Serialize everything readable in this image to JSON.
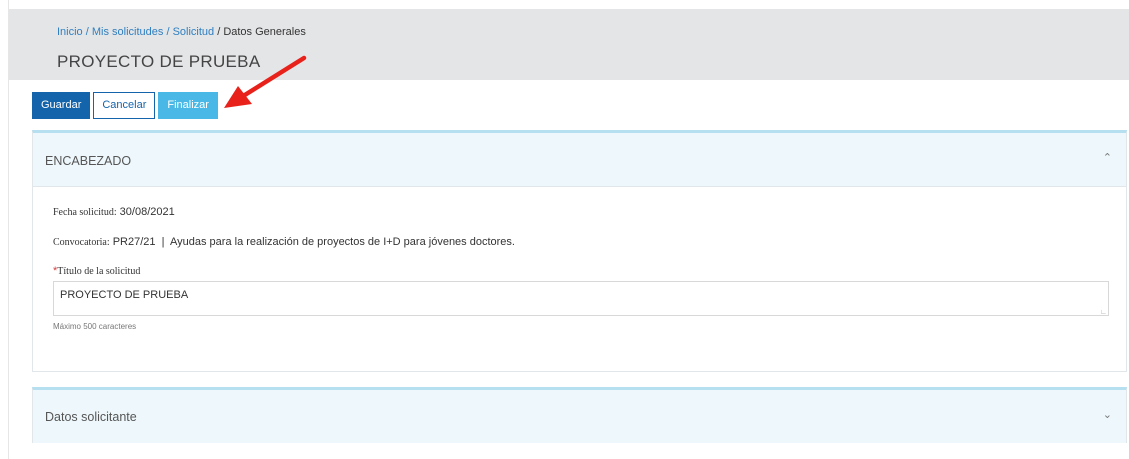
{
  "breadcrumb": {
    "inicio": "Inicio",
    "mis_solicitudes": "Mis solicitudes",
    "solicitud": "Solicitud",
    "current": "Datos Generales",
    "separator": " / "
  },
  "page": {
    "title": "PROYECTO DE PRUEBA"
  },
  "toolbar": {
    "guardar": "Guardar",
    "cancelar": "Cancelar",
    "finalizar": "Finalizar"
  },
  "encabezado": {
    "title": "ENCABEZADO",
    "fecha_label": "Fecha solicitud:",
    "fecha_value": "30/08/2021",
    "convocatoria_label": "Convocatoria:",
    "convocatoria_value": "PR27/21  |  Ayudas para la realización de proyectos de I+D para jóvenes doctores.",
    "titulo_required": "*",
    "titulo_label": "Título de la solicitud",
    "titulo_value": "PROYECTO DE PRUEBA",
    "titulo_hint": "Máximo 500 caracteres"
  },
  "datos_solicitante": {
    "title": "Datos solicitante"
  },
  "icons": {
    "megaphone": "megaphone-icon",
    "arrow": "red-arrow-icon",
    "collapse": "chevron-up-icon",
    "expand": "chevron-down-icon"
  },
  "colors": {
    "primary": "#1464ab",
    "accent": "#4ab8e6",
    "header_bg": "#e4e5e7",
    "panel_head_bg": "#eef8fc",
    "arrow": "#e8221b",
    "link": "#2f7fc1",
    "required": "#d23c3c"
  }
}
